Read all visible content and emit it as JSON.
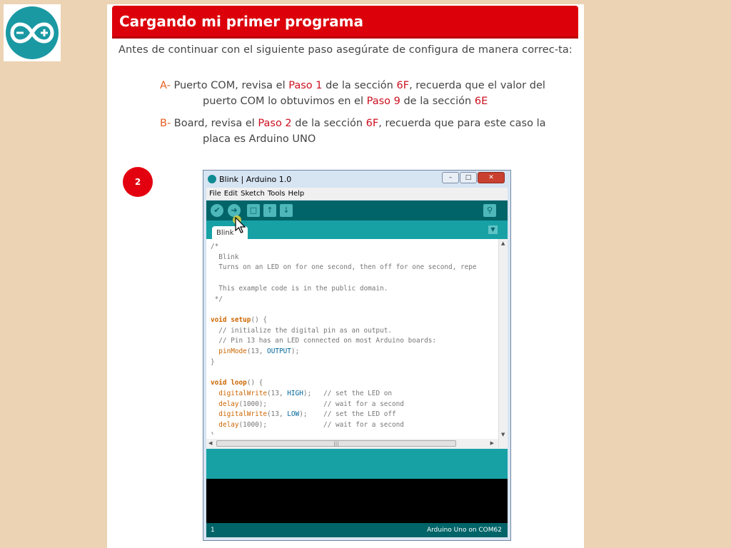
{
  "lesson": {
    "title": "Cargando mi primer programa",
    "intro": "Antes de continuar con el siguiente paso asegúrate de configura de manera correc-ta:",
    "item_a": {
      "letter": "A-",
      "t1": " Puerto COM, revisa el ",
      "r1": "Paso 1",
      "t2": " de la sección ",
      "r2": "6F",
      "t3": ", recuerda que el valor del",
      "t4": "puerto COM lo obtuvimos en el ",
      "r3": "Paso 9",
      "t5": " de la sección ",
      "r4": "6E"
    },
    "item_b": {
      "letter": "B-",
      "t1": " Board, revisa el ",
      "r1": "Paso 2",
      "t2": " de la sección ",
      "r2": "6F",
      "t3": ", recuerda que para este caso la",
      "t4": "placa es Arduino UNO"
    },
    "step_number": "2"
  },
  "ide": {
    "window_title": "Blink | Arduino 1.0",
    "menu": [
      "File",
      "Edit",
      "Sketch",
      "Tools",
      "Help"
    ],
    "tab_name": "Blink",
    "code": {
      "l1": "/*",
      "l2": "  Blink",
      "l3": "  Turns on an LED on for one second, then off for one second, repe",
      "l5": "  This example code is in the public domain.",
      "l6": " */",
      "setup_void": "void",
      "setup_fn": "setup",
      "setup_rest": "() {",
      "s1": "  // initialize the digital pin as an output.",
      "s2": "  // Pin 13 has an LED connected on most Arduino boards:",
      "s3_fn": "pinMode",
      "s3_a": "(13, ",
      "s3_c": "OUTPUT",
      "s3_b": ");",
      "close": "}",
      "loop_void": "void",
      "loop_fn": "loop",
      "loop_rest": "() {",
      "w1_fn": "digitalWrite",
      "w1_a": "(13, ",
      "w1_c": "HIGH",
      "w1_b": ");   // set the LED on",
      "d1_fn": "delay",
      "d1_b": "(1000);              // wait for a second",
      "w2_fn": "digitalWrite",
      "w2_a": "(13, ",
      "w2_c": "LOW",
      "w2_b": ");    // set the LED off",
      "d2_fn": "delay",
      "d2_b": "(1000);              // wait for a second"
    },
    "status_line": "1",
    "status_board": "Arduino Uno on COM62"
  },
  "colors": {
    "background": "#ecd3b3",
    "header_red": "#dc000a",
    "highlight_red": "#cc1020",
    "letter_orange": "#e55c20",
    "arduino_teal": "#006468",
    "arduino_light_teal": "#17a1a5"
  },
  "icons": [
    "arduino-logo-icon",
    "verify-icon",
    "upload-icon",
    "new-icon",
    "open-icon",
    "save-icon",
    "serial-monitor-icon",
    "cursor-icon"
  ]
}
